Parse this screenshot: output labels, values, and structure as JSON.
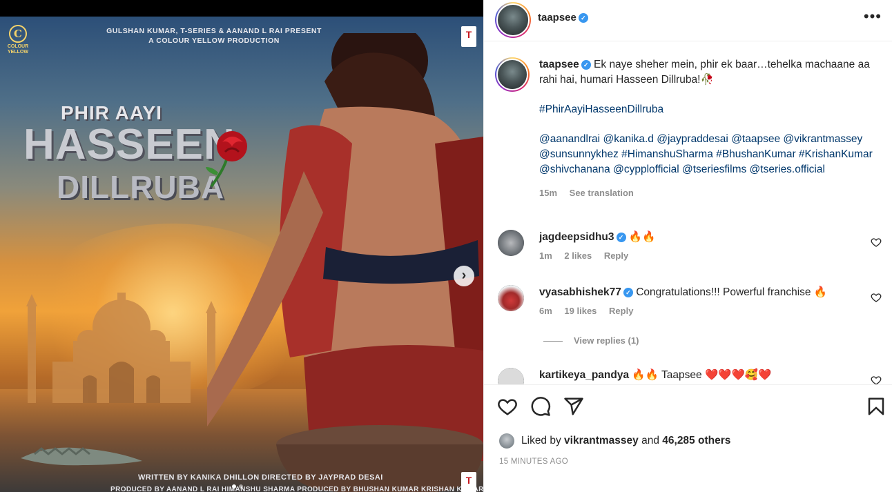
{
  "media": {
    "brand_logo_text": "COLOUR YELLOW",
    "present_line1": "GULSHAN KUMAR, T-SERIES & AANAND L RAI PRESENT",
    "present_line2": "A COLOUR YELLOW PRODUCTION",
    "studio_logo": "T",
    "title_line1": "PHIR AAYI",
    "title_line2": "HASSEEN",
    "title_line3": "DILLRUBA",
    "credits_line1": "WRITTEN BY KANIKA DHILLON DIRECTED BY JAYPRAD DESAI",
    "credits_line2": "PRODUCED BY AANAND L RAI HIMANSHU SHARMA PRODUCED BY BHUSHAN KUMAR KRISHAN KUMAR",
    "next_icon": "›",
    "carousel_active": 1
  },
  "post": {
    "username": "taapsee",
    "verified_mark": "✓",
    "more_icon": "•••",
    "caption_text": "Ek naye sheher mein, phir ek baar…tehelka machaane aa rahi hai, humari Hasseen Dillruba!🥀",
    "hashtag": "#PhirAayiHasseenDillruba",
    "mentions": [
      "@aanandlrai",
      "@kanika.d",
      "@jaypraddesai",
      "@taapsee",
      "@vikrantmassey",
      "@sunsunnykhez",
      "#HimanshuSharma",
      "#BhushanKumar",
      "#KrishanKumar",
      "@shivchanana",
      "@cypplofficial",
      "@tseriesfilms",
      "@tseries.official"
    ],
    "caption_age": "15m",
    "see_translation": "See translation"
  },
  "comments": [
    {
      "username": "jagdeepsidhu3",
      "verified": true,
      "text": "🔥🔥",
      "age": "1m",
      "likes": "2 likes",
      "reply": "Reply"
    },
    {
      "username": "vyasabhishek77",
      "verified": true,
      "text": "Congratulations!!! Powerful franchise 🔥",
      "age": "6m",
      "likes": "19 likes",
      "reply": "Reply"
    },
    {
      "username": "kartikeya_pandya",
      "verified": false,
      "text": "🔥🔥 Taapsee ❤️❤️❤️🥰❤️"
    }
  ],
  "view_replies": "View replies (1)",
  "footer": {
    "liked_by_prefix": "Liked by",
    "liked_by_user": "vikrantmassey",
    "liked_by_and": "and",
    "liked_by_count": "46,285 others",
    "timestamp": "15 MINUTES AGO"
  },
  "icons": {
    "like": "heart-icon",
    "comment": "comment-icon",
    "share": "send-icon",
    "save": "bookmark-icon"
  }
}
